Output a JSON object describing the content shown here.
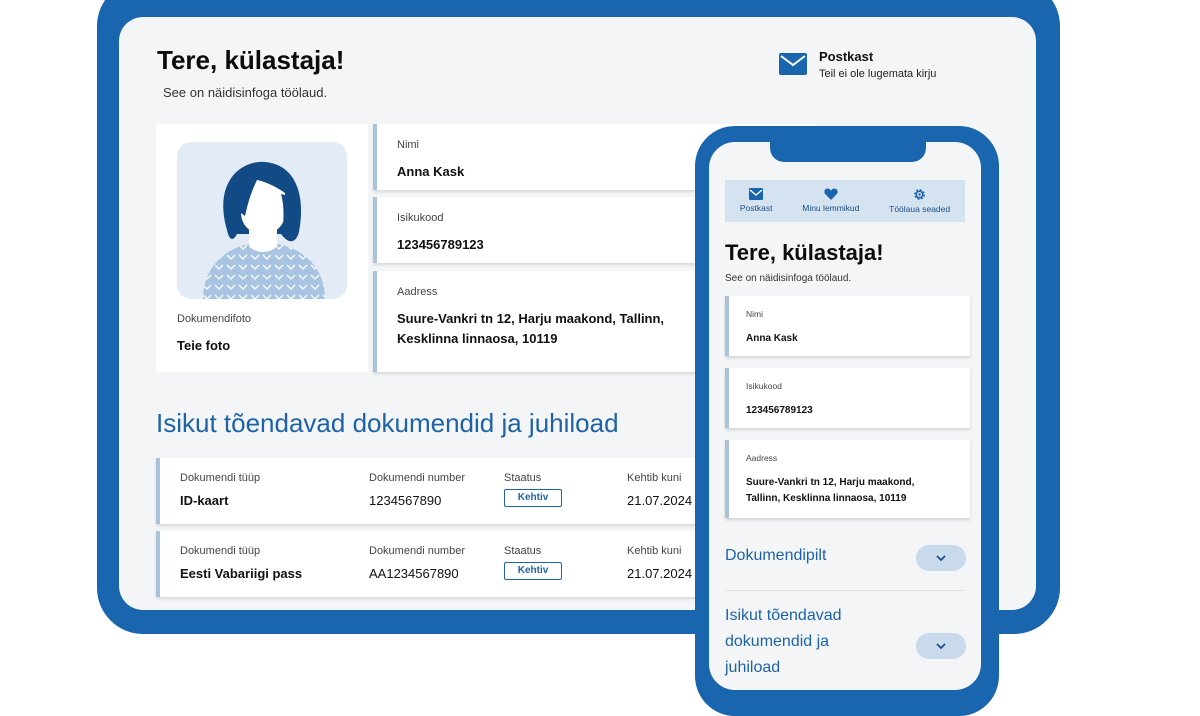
{
  "desktop": {
    "greeting": "Tere, külastaja!",
    "subtitle": "See on näidisinfoga töölaud.",
    "mailbox": {
      "title": "Postkast",
      "text": "Teil ei ole lugemata kirju",
      "icon": "mail-icon"
    },
    "photo": {
      "label": "Dokumendifoto",
      "value": "Teie foto"
    },
    "personal": [
      {
        "label": "Nimi",
        "value": "Anna Kask"
      },
      {
        "label": "Isikukood",
        "value": "123456789123"
      },
      {
        "label": "Aadress",
        "value_line1": "Suure-Vankri tn 12, Harju maakond, Tallinn,",
        "value_line2": "Kesklinna linnaosa, 10119"
      }
    ],
    "documents_title": "Isikut tõendavad dokumendid ja juhiload",
    "document_columns": [
      "Dokumendi tüüp",
      "Dokumendi number",
      "Staatus",
      "Kehtib kuni"
    ],
    "documents": [
      {
        "type": "ID-kaart",
        "number": "1234567890",
        "status": "Kehtiv",
        "valid_until": "21.07.2024"
      },
      {
        "type": "Eesti Vabariigi pass",
        "number": "AA1234567890",
        "status": "Kehtiv",
        "valid_until": "21.07.2024"
      }
    ]
  },
  "mobile": {
    "toolbar": [
      {
        "label": "Postkast",
        "icon": "mail-icon"
      },
      {
        "label": "Minu lemmikud",
        "icon": "heart-icon"
      },
      {
        "label": "Töölaua seaded",
        "icon": "gear-icon"
      }
    ],
    "greeting": "Tere, külastaja!",
    "subtitle": "See on näidisinfoga töölaud.",
    "cards": [
      {
        "label": "Nimi",
        "value": "Anna Kask"
      },
      {
        "label": "Isikukood",
        "value": "123456789123"
      },
      {
        "label": "Aadress",
        "value_line1": "Suure-Vankri tn 12, Harju maakond,",
        "value_line2": "Tallinn, Kesklinna linnaosa, 10119"
      }
    ],
    "accordions": [
      {
        "title": "Dokumendipilt"
      },
      {
        "title_line1": "Isikut tõendavad",
        "title_line2": "dokumendid ja",
        "title_line3": "juhiload"
      }
    ]
  },
  "colors": {
    "brand": "#1a66ae",
    "accent": "#1e63a8",
    "card_border": "#a9c3dd",
    "avatar_bg": "#e3ecf6"
  }
}
